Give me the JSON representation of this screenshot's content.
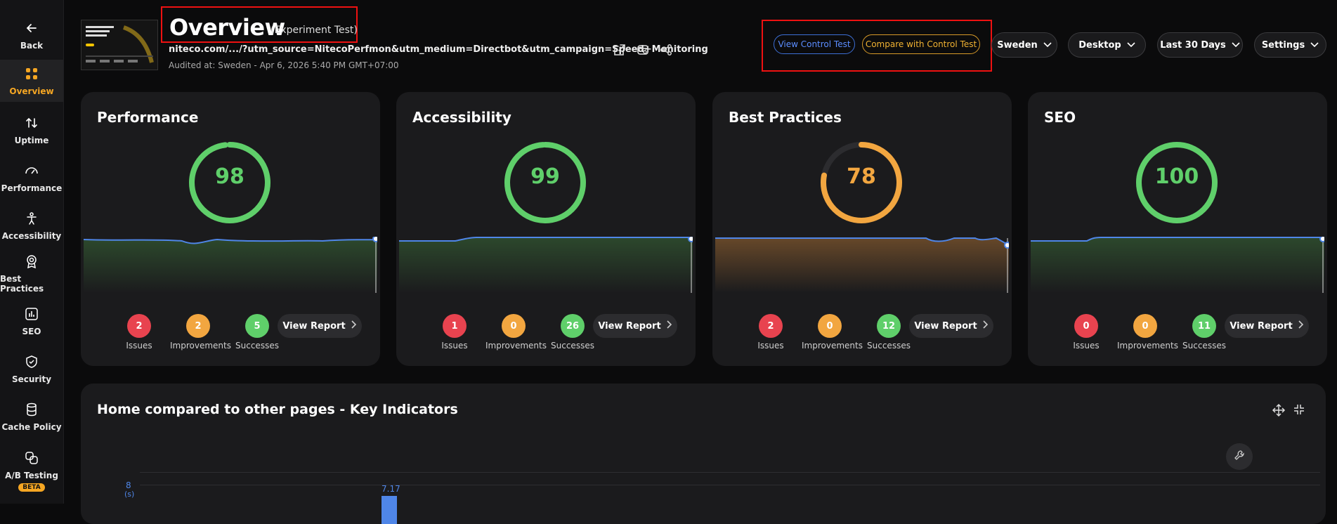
{
  "sidebar": {
    "back": "Back",
    "items": [
      {
        "label": "Overview",
        "icon": "grid-icon"
      },
      {
        "label": "Uptime",
        "icon": "arrows-updown-icon"
      },
      {
        "label": "Performance",
        "icon": "speedometer-icon"
      },
      {
        "label": "Accessibility",
        "icon": "person-icon"
      },
      {
        "label": "Best Practices",
        "icon": "award-icon"
      },
      {
        "label": "SEO",
        "icon": "bar-chart-icon"
      },
      {
        "label": "Security",
        "icon": "shield-icon"
      },
      {
        "label": "Cache Policy",
        "icon": "database-icon"
      },
      {
        "label": "A/B Testing",
        "icon": "ab-icon"
      }
    ],
    "beta": "BETA"
  },
  "header": {
    "title": "Overview",
    "subtitle": "(Experiment Test)",
    "url": "niteco.com/.../?utm_source=NitecoPerfmon&utm_medium=Directbot&utm_campaign=Speed+Monitoring",
    "audited": "Audited at: Sweden - Apr 6, 2026 5:40 PM GMT+07:00",
    "view_control": "View Control Test",
    "compare_control": "Compare with Control Test",
    "region": "Sweden",
    "device": "Desktop",
    "period": "Last 30 Days",
    "settings": "Settings"
  },
  "cards": [
    {
      "title": "Performance",
      "score": "98",
      "score_value": 98,
      "color": "#5fcf6a",
      "issues": "2",
      "improvements": "2",
      "successes": "5"
    },
    {
      "title": "Accessibility",
      "score": "99",
      "score_value": 99,
      "color": "#5fcf6a",
      "issues": "1",
      "improvements": "0",
      "successes": "26"
    },
    {
      "title": "Best Practices",
      "score": "78",
      "score_value": 78,
      "color": "#f2a640",
      "issues": "2",
      "improvements": "0",
      "successes": "12"
    },
    {
      "title": "SEO",
      "score": "100",
      "score_value": 100,
      "color": "#5fcf6a",
      "issues": "0",
      "improvements": "0",
      "successes": "11"
    }
  ],
  "labels": {
    "issues": "Issues",
    "improvements": "Improvements",
    "successes": "Successes",
    "view_report": "View Report"
  },
  "panel": {
    "title": "Home compared to other pages - Key Indicators",
    "y_tick": "8",
    "y_unit": "(s)",
    "bar_value": "7.17"
  },
  "colors": {
    "accent": "#f5a623",
    "issue": "#e8434f",
    "improvement": "#f2a640",
    "success": "#5fcf6a",
    "line": "#4f86e8"
  }
}
